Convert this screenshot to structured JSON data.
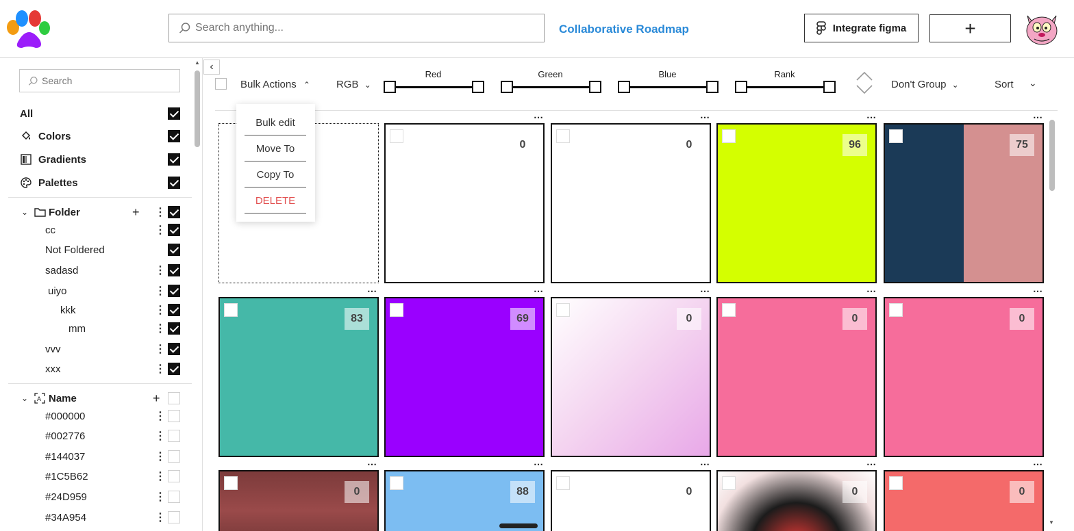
{
  "header": {
    "search_placeholder": "Search anything...",
    "roadmap_link": "Collaborative Roadmap",
    "figma_button": "Integrate figma",
    "add_button": "+"
  },
  "sidebar": {
    "search_placeholder": "Search",
    "categories": [
      {
        "label": "All",
        "checked": true
      },
      {
        "label": "Colors",
        "checked": true
      },
      {
        "label": "Gradients",
        "checked": true
      },
      {
        "label": "Palettes",
        "checked": true
      }
    ],
    "folder_section": {
      "label": "Folder",
      "items": [
        {
          "label": "cc"
        },
        {
          "label": "Not Foldered"
        },
        {
          "label": "sadasd"
        },
        {
          "label": "uiyo"
        },
        {
          "label": "kkk"
        },
        {
          "label": "mm"
        },
        {
          "label": "vvv"
        },
        {
          "label": "xxx"
        }
      ]
    },
    "name_section": {
      "label": "Name",
      "items": [
        {
          "label": "#000000"
        },
        {
          "label": "#002776"
        },
        {
          "label": "#144037"
        },
        {
          "label": "#1C5B62"
        },
        {
          "label": "#24D959"
        },
        {
          "label": "#34A954"
        }
      ]
    }
  },
  "toolbar": {
    "bulk_actions": "Bulk Actions",
    "color_mode": "RGB",
    "sliders": [
      {
        "label": "Red"
      },
      {
        "label": "Green"
      },
      {
        "label": "Blue"
      },
      {
        "label": "Rank"
      }
    ],
    "group": "Don't Group",
    "sort": "Sort"
  },
  "bulk_menu": [
    {
      "label": "Bulk edit"
    },
    {
      "label": "Move To"
    },
    {
      "label": "Copy To"
    },
    {
      "label": "DELETE"
    }
  ],
  "tiles": [
    {
      "rank": ""
    },
    {
      "rank": "0"
    },
    {
      "rank": "0"
    },
    {
      "rank": "96"
    },
    {
      "rank": "75"
    },
    {
      "rank": "83"
    },
    {
      "rank": "69"
    },
    {
      "rank": "0"
    },
    {
      "rank": "0"
    },
    {
      "rank": "0"
    },
    {
      "rank": "0"
    },
    {
      "rank": "88"
    },
    {
      "rank": "0"
    },
    {
      "rank": "0"
    },
    {
      "rank": "0"
    }
  ],
  "colors": {
    "accent": "#2a8ad8",
    "danger": "#e25050",
    "lime": "#d4ff00",
    "navy": "#1b3a57",
    "dusty_rose": "#d49090",
    "teal": "#45b8a8",
    "violet": "#9a00ff",
    "pink": "#f66d9b",
    "maroon": "#7c3b3b",
    "sky": "#7cbdf2",
    "salmon": "#f46a6a"
  }
}
